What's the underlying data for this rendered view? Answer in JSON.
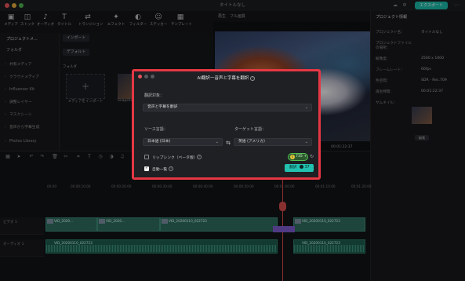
{
  "window": {
    "title": "タイトルなし",
    "export_label": "エクスポート"
  },
  "toolbar": {
    "items": [
      {
        "label": "メディア",
        "icon": "media-icon"
      },
      {
        "label": "ストック",
        "icon": "stock-icon"
      },
      {
        "label": "オーディオ",
        "icon": "audio-icon"
      },
      {
        "label": "タイトル",
        "icon": "title-icon"
      },
      {
        "label": "トランジション",
        "icon": "transition-icon"
      },
      {
        "label": "エフェクト",
        "icon": "effect-icon"
      },
      {
        "label": "フィルター",
        "icon": "filter-icon"
      },
      {
        "label": "ステッカー",
        "icon": "sticker-icon"
      },
      {
        "label": "テンプレート",
        "icon": "template-icon"
      }
    ]
  },
  "sidebar": {
    "top": "プロジェクトメ...",
    "folder": "フォルダ",
    "items": [
      "共有メディア",
      "クラウドメディア",
      "Influencer Kit",
      "調整レイヤー",
      "マスクシーン",
      "音声から字幕生成",
      "Photos Library"
    ]
  },
  "media": {
    "import_button": "インポート",
    "default_button": "デフォルト",
    "folder_label": "フォルダ",
    "import_tile_label": "メディアをインポート",
    "thumb_label": "Snapshot"
  },
  "preview": {
    "bar_text": "再生　フル画質",
    "time_current": "00:00:12:28",
    "time_total": "00:01:22:37"
  },
  "properties": {
    "tab": "プロジェクト情報",
    "rows": [
      {
        "label": "プロジェクト名：",
        "value": "タイトルなし"
      },
      {
        "label": "プロジェクトファイルの場所：",
        "value": "/"
      },
      {
        "label": "解像度：",
        "value": "2560 x 1600"
      },
      {
        "label": "フレームレート：",
        "value": "60fps"
      },
      {
        "label": "色空間：",
        "value": "SDR - Rec.709"
      },
      {
        "label": "再生時間：",
        "value": "00:01:22:37"
      },
      {
        "label": "サムネイル：",
        "value": ""
      }
    ],
    "edit_label": "編集"
  },
  "timeline": {
    "ruler": [
      "00:00",
      "00:00:10:00",
      "00:00:20:00",
      "00:00:30:00",
      "00:00:40:00",
      "00:00:50:00",
      "00:01:00:00",
      "00:01:10:00",
      "00:01:20:00"
    ],
    "video_clips": [
      "VID_2020...",
      "VID_2020...",
      "VID_20200110_022723",
      "VID_20200110_022723"
    ],
    "audio_clips": [
      "VID_20200110_022723",
      "VID_20200110_022723"
    ],
    "track_video_label": "ビデオ 1",
    "track_audio_label": "オーディオ 1"
  },
  "dialog": {
    "title": "AI翻訳ー音声と字幕を翻訳",
    "target_label": "翻訳対象：",
    "target_value": "音声と字幕を翻訳",
    "source_label": "ソース言語：",
    "source_value": "日本語 (日本)",
    "dest_label": "ターゲット言語：",
    "dest_value": "英語 (アメリカ)",
    "lipsync_label": "リップシンク（ベータ版）",
    "lipsync_checked": false,
    "auto_adjust_label": "自動一覧",
    "auto_adjust_checked": true,
    "credits": "735",
    "credits_plus": "+",
    "translate_label": "翻訳",
    "translate_cost": "37",
    "accent_color": "#22c1b0",
    "frame_color": "#e63744"
  }
}
